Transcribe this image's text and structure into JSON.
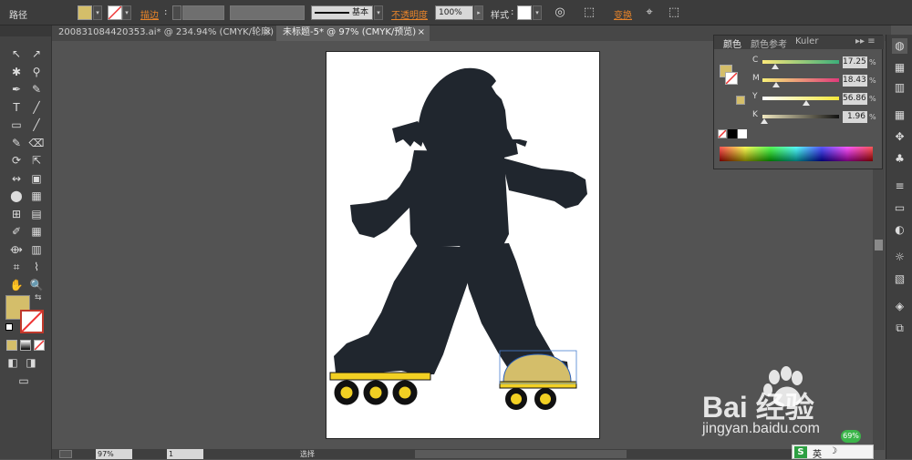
{
  "control_bar": {
    "mode_label": "路径",
    "stroke_label": "描边",
    "stroke_profile": "基本",
    "opacity_label": "不透明度",
    "opacity_value": "100%",
    "style_label": "样式",
    "transform_label": "变换",
    "fill_color": "#d4be6a"
  },
  "tabs": [
    {
      "label": "200831084420353.ai* @ 234.94% (CMYK/轮廓)",
      "close": "×"
    },
    {
      "label": "未标题-5* @ 97% (CMYK/预览)",
      "close": "×"
    }
  ],
  "color_panel": {
    "tabs": [
      "颜色",
      "颜色参考",
      "Kuler"
    ],
    "menu_glyph": "▸▸ ≡",
    "channels": [
      {
        "label": "C",
        "value": "17.25",
        "level": 0.17,
        "grad": "linear-gradient(to right,#fbe87a,#3cae7a)"
      },
      {
        "label": "M",
        "value": "18.43",
        "level": 0.18,
        "grad": "linear-gradient(to right,#f6ef78,#e03a7a)"
      },
      {
        "label": "Y",
        "value": "56.86",
        "level": 0.57,
        "grad": "linear-gradient(to right,#ffffff,#f5e83a)"
      },
      {
        "label": "K",
        "value": "1.96",
        "level": 0.02,
        "grad": "linear-gradient(to right,#f0e8c0,#111111)"
      }
    ],
    "pct_sign": "%",
    "swatch_color": "#d4be6a"
  },
  "left_tools": [
    "↖",
    "↗",
    "✱",
    "⚲",
    "✒",
    "✎",
    "T",
    "╱",
    "▭",
    "╱",
    "✎",
    "⌫",
    "⟳",
    "⇱",
    "↭",
    "▣",
    "⬤",
    "▦",
    "⊞",
    "▤",
    "✐",
    "▦",
    "⟴",
    "▥",
    "⌗",
    "⌇",
    "✋",
    "🔍"
  ],
  "status": {
    "zoom": "97%",
    "page": "1",
    "selection_label": "选择"
  },
  "watermark": {
    "brand": "Bai 经验",
    "url": "jingyan.baidu.com"
  },
  "tray": {
    "ime_label": "英",
    "badge": "69%"
  }
}
